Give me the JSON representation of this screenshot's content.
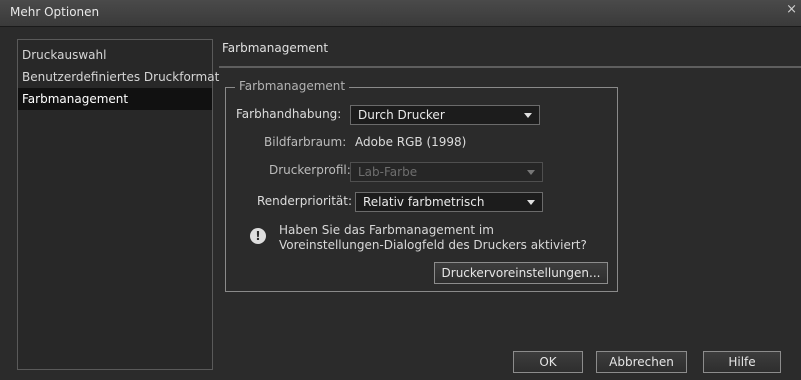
{
  "window": {
    "title": "Mehr Optionen",
    "close_glyph": "×"
  },
  "sidebar": {
    "items": [
      {
        "label": "Druckauswahl"
      },
      {
        "label": "Benutzerdefiniertes Druckformat"
      },
      {
        "label": "Farbmanagement",
        "selected": true
      }
    ]
  },
  "main": {
    "heading": "Farbmanagement",
    "group": {
      "legend": "Farbmanagement",
      "handling_label": "Farbhandhabung:",
      "handling_value": "Durch Drucker",
      "colorspace_label": "Bildfarbraum:",
      "colorspace_value": "Adobe RGB (1998)",
      "profile_label": "Druckerprofil:",
      "profile_value": "Lab-Farbe",
      "intent_label": "Renderpriorität:",
      "intent_value": "Relativ farbmetrisch",
      "warning_text": "Haben Sie das Farbmanagement im Voreinstellungen-Dialogfeld des Druckers aktiviert?",
      "prefs_button": "Druckervoreinstellungen..."
    }
  },
  "footer": {
    "ok": "OK",
    "cancel": "Abbrechen",
    "help": "Hilfe"
  },
  "colors": {
    "background": "#2b2b2b",
    "selected_item": "#111111",
    "border": "#8a8a8a"
  }
}
